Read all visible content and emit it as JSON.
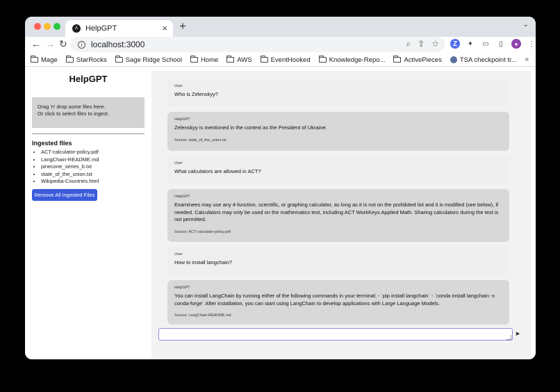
{
  "browser": {
    "tab_title": "HelpGPT",
    "tab_favicon": "A",
    "tab_close": "×",
    "new_tab": "+",
    "tab_menu": "⌄",
    "url": "localhost:3000",
    "nav": {
      "back": "←",
      "forward": "→",
      "reload": "↻",
      "info": "i"
    },
    "omnibox_icons": {
      "search": "⌕",
      "share": "⇪",
      "star": "☆"
    },
    "extensions": {
      "zoom": "Z",
      "puzzle": "✦",
      "cast": "▭",
      "sidepanel": "▯",
      "profile": "●",
      "menu": "⋮"
    },
    "bookmarks": [
      {
        "label": "Mage"
      },
      {
        "label": "StarRocks"
      },
      {
        "label": "Sage Ridge School"
      },
      {
        "label": "Home"
      },
      {
        "label": "AWS"
      },
      {
        "label": "EventHooked"
      },
      {
        "label": "Knowledge-Repo..."
      },
      {
        "label": "ActivePieces"
      },
      {
        "label": "TSA checkpoint tr..."
      }
    ],
    "bookmarks_more": "»"
  },
  "sidebar": {
    "title": "HelpGPT",
    "dropzone_line1": "Drag 'n' drop some files here.",
    "dropzone_line2": "Or click to select files to ingest.",
    "ingested_heading": "Ingested files",
    "files": [
      "ACT-calculator-policy.pdf",
      "LangChain-README.md",
      "pinecone_series_b.txt",
      "state_of_the_union.txt",
      "Wikipedia-Countries.html"
    ],
    "remove_button": "Remove All Ingested Files"
  },
  "chat": {
    "messages": [
      {
        "role": "User",
        "text": "Who is Zelenskyy?"
      },
      {
        "role": "HelpGPT",
        "text": "Zelenskyy is mentioned in the context as the President of Ukraine.",
        "source": "Source: state_of_the_union.txt"
      },
      {
        "role": "User",
        "text": "What calculators are allowed in ACT?"
      },
      {
        "role": "HelpGPT",
        "text": "Examinees may use any 4-function, scientific, or graphing calculator, as long as it is not on the prohibited list and it is modified (see below), if needed. Calculators may only be used on the mathematics test, including ACT WorkKeys Applied Math. Sharing calculators during the test is not permitted.",
        "source": "Source: ACT-calculator-policy.pdf"
      },
      {
        "role": "User",
        "text": "How to install langchain?"
      },
      {
        "role": "HelpGPT",
        "text": "You can install LangChain by running either of the following commands in your terminal: - `pip install langchain` - `conda install langchain -c conda-forge` After installation, you can start using LangChain to develop applications with Large Language Models.",
        "source": "Source: LangChain-README.md"
      }
    ],
    "input_value": "",
    "send_icon": "➤"
  }
}
